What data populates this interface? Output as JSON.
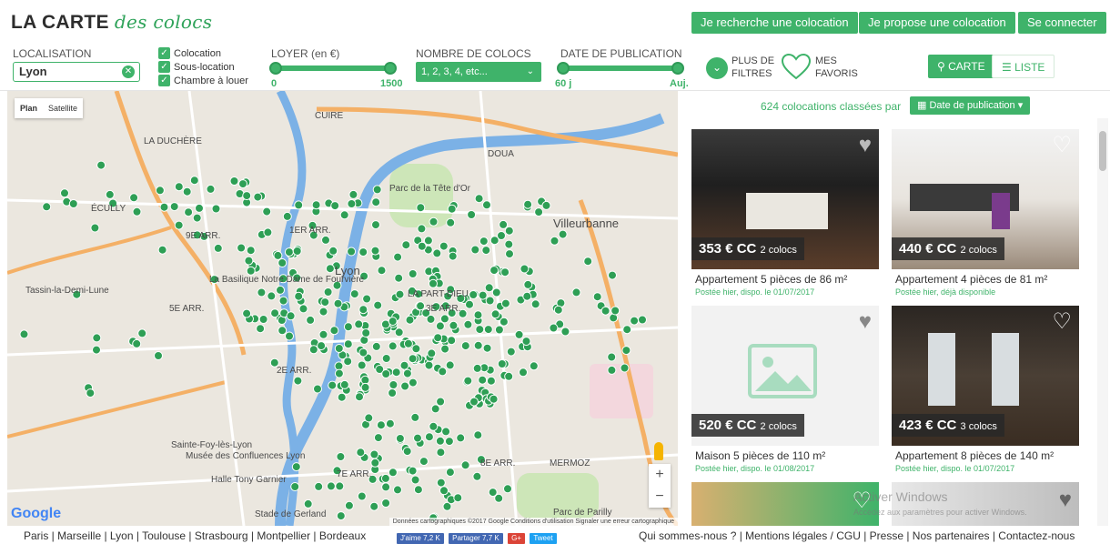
{
  "header": {
    "logo_main": "LA CARTE",
    "logo_script": "des colocs",
    "btn_search": "Je recherche une colocation",
    "btn_offer": "Je propose une colocation",
    "btn_login": "Se connecter"
  },
  "filters": {
    "location_label": "LOCALISATION",
    "location_value": "Lyon",
    "checkboxes": [
      "Colocation",
      "Sous-location",
      "Chambre à louer"
    ],
    "rent_label": "LOYER (en €)",
    "rent_min": "0",
    "rent_max": "1500",
    "colocs_label": "NOMBRE DE COLOCS",
    "colocs_value": "1, 2, 3, 4, etc...",
    "date_label": "DATE DE PUBLICATION",
    "date_min": "60 j",
    "date_max": "Auj.",
    "more_filters_1": "PLUS DE",
    "more_filters_2": "FILTRES",
    "favs_1": "MES",
    "favs_2": "FAVORIS",
    "view_map": "CARTE",
    "view_list": "LISTE"
  },
  "map": {
    "tab_plan": "Plan",
    "tab_satellite": "Satellite",
    "google": "Google",
    "credit": "Données cartographiques ©2017 Google   Conditions d'utilisation   Signaler une erreur cartographique",
    "labels": [
      "LA DUCHÈRE",
      "CUIRE",
      "9E ARR.",
      "1ER ARR.",
      "Villeurbanne",
      "Lyon",
      "Tassin-la-Demi-Lune",
      "5E ARR.",
      "LA PART-DIEU",
      "3E ARR.",
      "2E ARR.",
      "7E ARR.",
      "8E ARR.",
      "MERMOZ",
      "Sainte-Foy-lès-Lyon",
      "Stade de Gerland",
      "Parc de la Tête d'Or",
      "DOUA",
      "Parc de Parilly",
      "La Basilique Notre Dame de Fourvière",
      "Musée des Confluences Lyon",
      "Halle Tony Garnier",
      "ÉCULLY"
    ]
  },
  "results": {
    "count": "624",
    "count_suffix": "colocations classées par",
    "sort": "Date de publication"
  },
  "listings": [
    {
      "price": "353 € CC",
      "colocs": "2 colocs",
      "title": "Appartement 5 pièces de 86 m²",
      "sub": "Postée hier, dispo. le 01/07/2017"
    },
    {
      "price": "440 € CC",
      "colocs": "2 colocs",
      "title": "Appartement 4 pièces de 81 m²",
      "sub": "Postée hier, déjà disponible"
    },
    {
      "price": "520 € CC",
      "colocs": "2 colocs",
      "title": "Maison 5 pièces de 110 m²",
      "sub": "Postée hier, dispo. le 01/08/2017"
    },
    {
      "price": "423 € CC",
      "colocs": "3 colocs",
      "title": "Appartement 8 pièces de 140 m²",
      "sub": "Postée hier, dispo. le 01/07/2017"
    }
  ],
  "watermark": {
    "line1": "Activer Windows",
    "line2": "Accédez aux paramètres pour activer Windows."
  },
  "footer": {
    "cities": "Paris | Marseille | Lyon | Toulouse | Strasbourg | Montpellier | Bordeaux",
    "fb_like": "J'aime 7,2 K",
    "fb_share": "Partager 7,7 K",
    "gplus": "G+",
    "tweet": "Tweet",
    "links": "Qui sommes-nous ?  |  Mentions légales / CGU  |  Presse  |  Nos partenaires  |  Contactez-nous"
  },
  "colors": {
    "accent": "#3fb36a",
    "marker": "#2e9f55",
    "water": "#7bb1e6",
    "highway": "#f4b066"
  }
}
